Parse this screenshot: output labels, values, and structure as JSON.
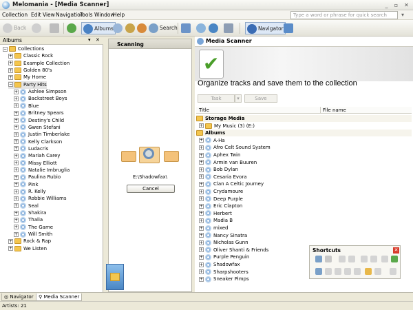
{
  "window": {
    "title": "Melomania - [Media Scanner]",
    "minimize": "_",
    "restore": "▫",
    "close": "✕"
  },
  "menu": [
    "Collection",
    "Edit",
    "View",
    "Navigation",
    "Tools",
    "Window",
    "Help"
  ],
  "quick_search": {
    "placeholder": "Type a word or phrase for quick search",
    "button": "▾"
  },
  "toolbar": {
    "back": "Back",
    "albums": "Albums",
    "search": "Search",
    "navigator": "Navigator"
  },
  "left_pane": {
    "title": "Albums",
    "tree": [
      {
        "label": "Collections",
        "level": 0,
        "kind": "root",
        "exp": "−"
      },
      {
        "label": "Classic Rock",
        "level": 1,
        "kind": "folder",
        "exp": "+"
      },
      {
        "label": "Example Collection",
        "level": 1,
        "kind": "folder",
        "exp": "+"
      },
      {
        "label": "Golden 80's",
        "level": 1,
        "kind": "folder",
        "exp": "+"
      },
      {
        "label": "My Home",
        "level": 1,
        "kind": "folder",
        "exp": "+"
      },
      {
        "label": "Party Hits",
        "level": 1,
        "kind": "folder",
        "exp": "−",
        "selected": true
      },
      {
        "label": "Ashlee Simpson",
        "level": 2,
        "kind": "artist",
        "exp": "+"
      },
      {
        "label": "Backstreet Boys",
        "level": 2,
        "kind": "artist",
        "exp": "+"
      },
      {
        "label": "Blue",
        "level": 2,
        "kind": "artist",
        "exp": "+"
      },
      {
        "label": "Britney Spears",
        "level": 2,
        "kind": "artist",
        "exp": "+"
      },
      {
        "label": "Destiny's Child",
        "level": 2,
        "kind": "artist",
        "exp": "+"
      },
      {
        "label": "Gwen Stefani",
        "level": 2,
        "kind": "artist",
        "exp": "+"
      },
      {
        "label": "Justin Timberlake",
        "level": 2,
        "kind": "artist",
        "exp": "+"
      },
      {
        "label": "Kelly Clarkson",
        "level": 2,
        "kind": "artist",
        "exp": "+"
      },
      {
        "label": "Ludacris",
        "level": 2,
        "kind": "artist",
        "exp": "+"
      },
      {
        "label": "Mariah Carey",
        "level": 2,
        "kind": "artist",
        "exp": "+"
      },
      {
        "label": "Missy Elliott",
        "level": 2,
        "kind": "artist",
        "exp": "+"
      },
      {
        "label": "Natalie Imbruglia",
        "level": 2,
        "kind": "artist",
        "exp": "+"
      },
      {
        "label": "Paulina Rubio",
        "level": 2,
        "kind": "artist",
        "exp": "+"
      },
      {
        "label": "Pink",
        "level": 2,
        "kind": "artist",
        "exp": "+"
      },
      {
        "label": "R. Kelly",
        "level": 2,
        "kind": "artist",
        "exp": "+"
      },
      {
        "label": "Robbie Williams",
        "level": 2,
        "kind": "artist",
        "exp": "+"
      },
      {
        "label": "Seal",
        "level": 2,
        "kind": "artist",
        "exp": "+"
      },
      {
        "label": "Shakira",
        "level": 2,
        "kind": "artist",
        "exp": "+"
      },
      {
        "label": "Thalia",
        "level": 2,
        "kind": "artist",
        "exp": "+"
      },
      {
        "label": "The Game",
        "level": 2,
        "kind": "artist",
        "exp": "+"
      },
      {
        "label": "Will Smith",
        "level": 2,
        "kind": "artist",
        "exp": "+"
      },
      {
        "label": "Rock & Rap",
        "level": 1,
        "kind": "folder",
        "exp": "+"
      },
      {
        "label": "We Listen",
        "level": 1,
        "kind": "folder",
        "exp": "+"
      }
    ]
  },
  "scanner": {
    "title": "Scanning",
    "path": "E:\\Shadowfax\\",
    "cancel": "Cancel"
  },
  "right_pane": {
    "title": "Media Scanner",
    "heading": "Organize tracks and save them to the collection",
    "task_button": "Task",
    "save_button": "Save",
    "columns": [
      "Title",
      "File name"
    ],
    "storage_group": "Storage Media",
    "storage_items": [
      "My Music (3) (E:)"
    ],
    "albums_group": "Albums",
    "albums": [
      "A-Ha",
      "Afro Celt Sound System",
      "Aphex Twin",
      "Armin van Buuren",
      "Bob Dylan",
      "Cesaria Evora",
      "Clan A Celtic Journey",
      "Crydamoure",
      "Deep Purple",
      "Eric Clapton",
      "Herbert",
      "Madia B",
      "mixed",
      "Nancy Sinatra",
      "Nicholas Gunn",
      "Oliver Shanti & Friends",
      "Purple Penguin",
      "Shadowfax",
      "Sharpshooters",
      "Sneaker Pimps"
    ]
  },
  "shortcuts": {
    "title": "Shortcuts"
  },
  "tabs": [
    {
      "label": "Navigator"
    },
    {
      "label": "Media Scanner",
      "active": true
    }
  ],
  "status": {
    "text": "Artists: 21"
  },
  "colors": {
    "accent": "#3a78b8",
    "folder": "#f4c64e",
    "check": "#4a9e2a"
  }
}
